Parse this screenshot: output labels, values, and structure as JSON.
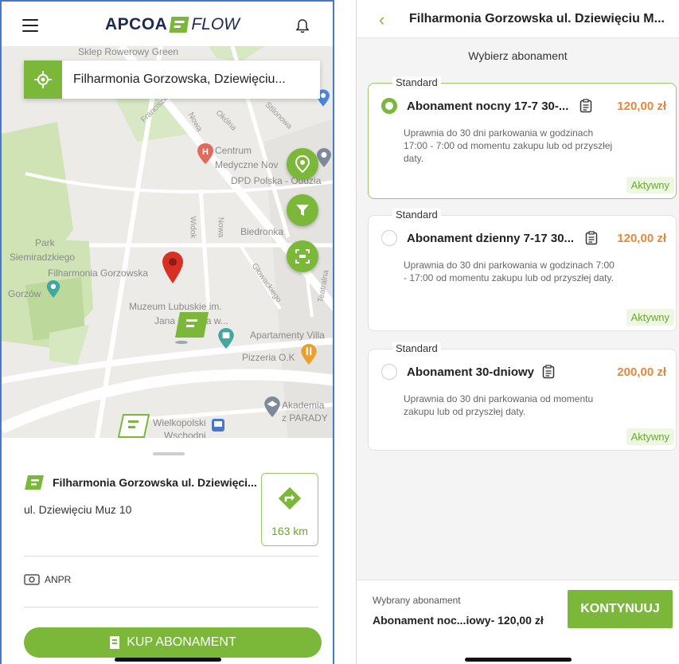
{
  "left": {
    "logo": {
      "brand": "APCOA",
      "product": "FLOW"
    },
    "search": {
      "value": "Filharmonia Gorzowska, Dziewięciu..."
    },
    "map_labels": {
      "sklep": "Sklep Rowerowy Green",
      "franciszka": "Franciszka",
      "nowa1": "Nowa",
      "okolna": "Okólna",
      "stilonowa": "Stilonowa",
      "centrum": "Centrum",
      "medyczne": "Medyczne Nov",
      "dpd": "DPD Polska - Oddzia",
      "widok": "Widok",
      "nowa2": "Nowa",
      "biedronka": "Biedronka",
      "park1": "Park",
      "park2": "Siemiradzkiego",
      "filharmonia": "Filharmonia Gorzowska",
      "gorzow": "Gorzów",
      "glowackiego": "Głowackiego",
      "teatralna": "Teatralna",
      "muzeum1": "Muzeum Lubuskie im.",
      "muzeum2": "Jana Dekerta w...",
      "apartamenty": "Apartamenty Villa",
      "pizzeria": "Pizzeria O.K",
      "akademia1": "Akademia",
      "akademia2": "z PARADY",
      "wielkopolski1": "Wielkopolski",
      "wielkopolski2": "Wschodni"
    },
    "place": {
      "name": "Filharmonia Gorzowska ul. Dziewięci...",
      "address": "ul. Dziewięciu Muz 10",
      "distance": "163 km"
    },
    "anpr_label": "ANPR",
    "kup_label": "KUP ABONAMENT"
  },
  "right": {
    "title": "Filharmonia Gorzowska ul. Dziewięciu M...",
    "subtitle": "Wybierz abonament",
    "cards": [
      {
        "legend": "Standard",
        "name": "Abonament nocny 17-7 30-...",
        "price": "120,00 zł",
        "desc": "Uprawnia do 30 dni parkowania w godzinach 17:00 - 7:00 od momentu zakupu lub od przyszłej daty.",
        "status": "Aktywny",
        "selected": true
      },
      {
        "legend": "Standard",
        "name": "Abonament dzienny 7-17 30...",
        "price": "120,00 zł",
        "desc": "Uprawnia do 30 dni parkowania w godzinach 7:00 - 17:00 od momentu zakupu lub od przyszłej daty.",
        "status": "Aktywny",
        "selected": false
      },
      {
        "legend": "Standard",
        "name": "Abonament 30-dniowy",
        "price": "200,00 zł",
        "desc": "Uprawnia do 30 dni parkowania od momentu zakupu lub od przyszłej daty.",
        "status": "Aktywny",
        "selected": false
      }
    ],
    "footer": {
      "label": "Wybrany abonament",
      "value": "Abonament noc...iowy- 120,00 zł",
      "button": "KONTYNUUJ"
    }
  },
  "colors": {
    "accent": "#7bb83a",
    "price": "#e8863a",
    "brand": "#1a2a55"
  }
}
